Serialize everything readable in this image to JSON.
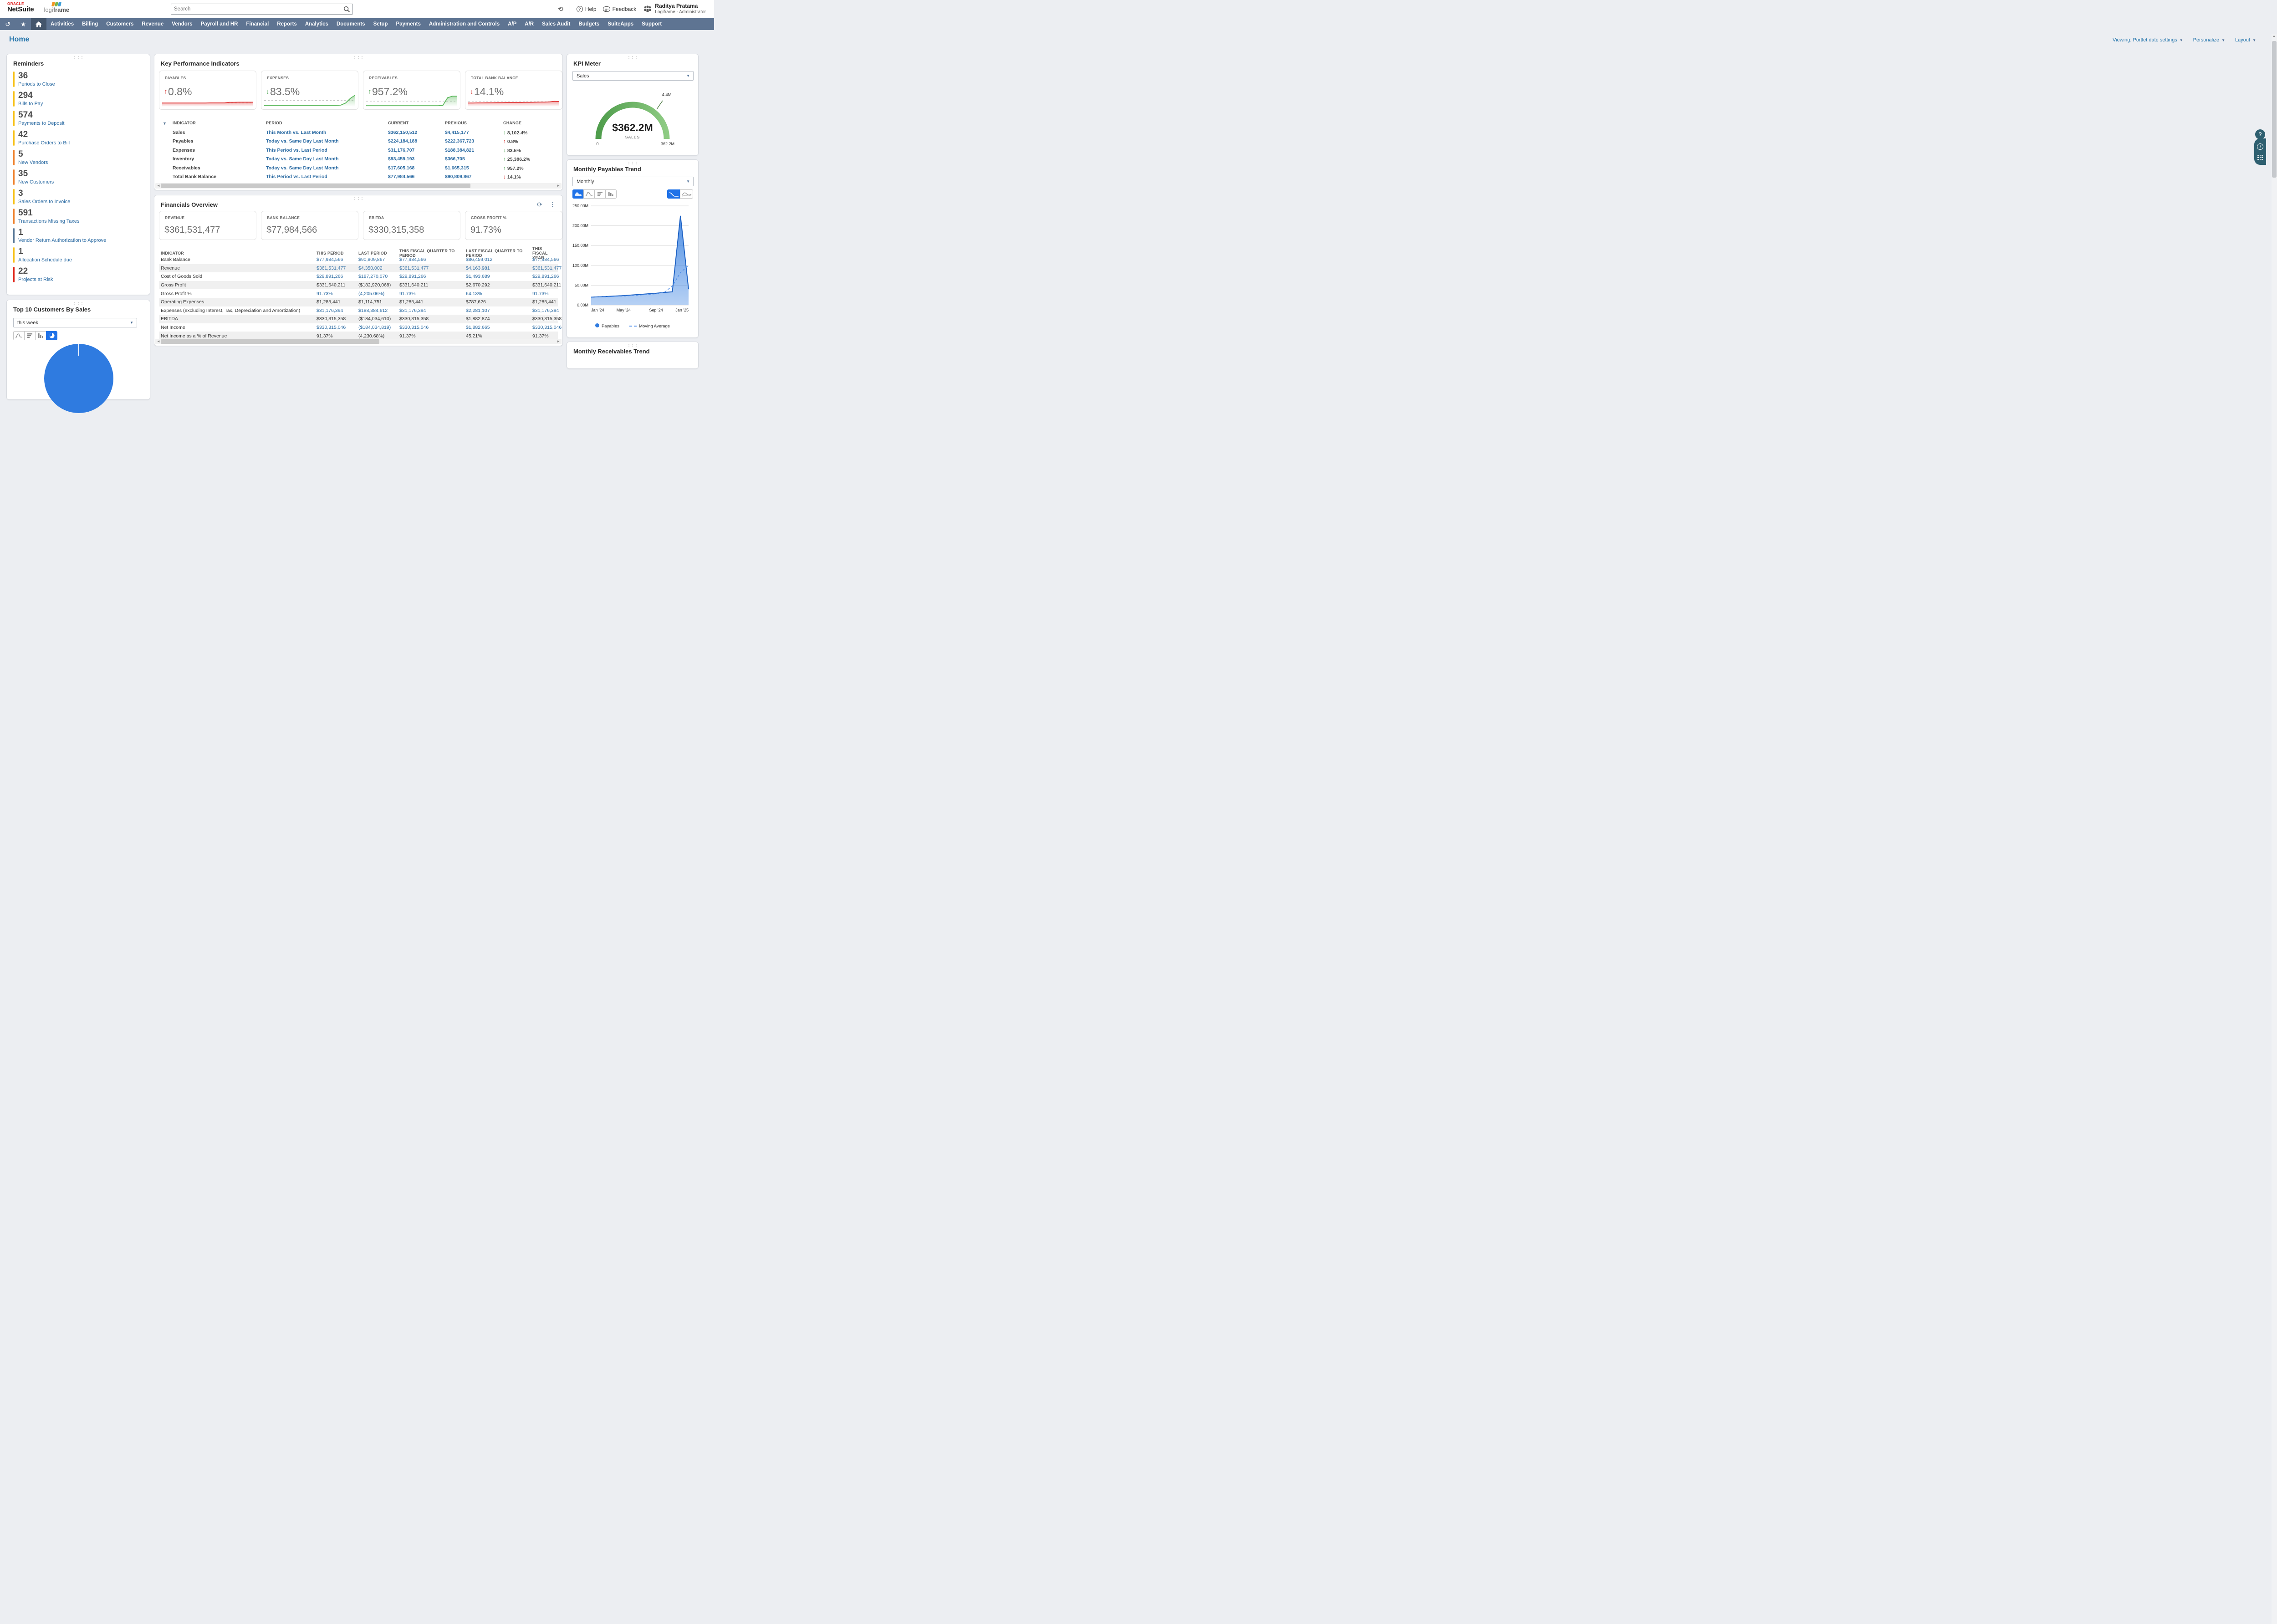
{
  "header": {
    "brand": {
      "oracle": "ORACLE",
      "netsuite": "NetSuite",
      "partner_light": "logi",
      "partner_bold": "frame"
    },
    "search": {
      "placeholder": "Search"
    },
    "help_label": "Help",
    "feedback_label": "Feedback",
    "user": {
      "name": "Raditya Pratama",
      "role": "Logiframe - Administrator"
    }
  },
  "nav": {
    "items": [
      "Activities",
      "Billing",
      "Customers",
      "Revenue",
      "Vendors",
      "Payroll and HR",
      "Financial",
      "Reports",
      "Analytics",
      "Documents",
      "Setup",
      "Payments",
      "Administration and Controls",
      "A/P",
      "A/R",
      "Sales Audit",
      "Budgets",
      "SuiteApps",
      "Support"
    ]
  },
  "page": {
    "title": "Home",
    "viewing_label": "Viewing: Portlet date settings",
    "personalize_label": "Personalize",
    "layout_label": "Layout"
  },
  "reminders": {
    "title": "Reminders",
    "items": [
      {
        "count": "36",
        "label": "Periods to Close",
        "color": "#f7c21d"
      },
      {
        "count": "294",
        "label": "Bills to Pay",
        "color": "#f7c21d"
      },
      {
        "count": "574",
        "label": "Payments to Deposit",
        "color": "#f7c21d"
      },
      {
        "count": "42",
        "label": "Purchase Orders to Bill",
        "color": "#f7c21d"
      },
      {
        "count": "5",
        "label": "New Vendors",
        "color": "#ef8432"
      },
      {
        "count": "35",
        "label": "New Customers",
        "color": "#ef8432"
      },
      {
        "count": "3",
        "label": "Sales Orders to Invoice",
        "color": "#f7c21d"
      },
      {
        "count": "591",
        "label": "Transactions Missing Taxes",
        "color": "#ef8432"
      },
      {
        "count": "1",
        "label": "Vendor Return Authorization to Approve",
        "color": "#5b7a99"
      },
      {
        "count": "1",
        "label": "Allocation Schedule due",
        "color": "#f7c21d"
      },
      {
        "count": "22",
        "label": "Projects at Risk",
        "color": "#e02b20"
      }
    ]
  },
  "top10": {
    "title": "Top 10 Customers By Sales",
    "range_value": "this week"
  },
  "kpi": {
    "title": "Key Performance Indicators",
    "cards": [
      {
        "label": "PAYABLES",
        "value": "0.8%",
        "dir": "up",
        "tone": "bad"
      },
      {
        "label": "EXPENSES",
        "value": "83.5%",
        "dir": "down",
        "tone": "good"
      },
      {
        "label": "RECEIVABLES",
        "value": "957.2%",
        "dir": "up",
        "tone": "good"
      },
      {
        "label": "TOTAL BANK BALANCE",
        "value": "14.1%",
        "dir": "down",
        "tone": "bad"
      }
    ],
    "table": {
      "headers": [
        "INDICATOR",
        "PERIOD",
        "CURRENT",
        "PREVIOUS",
        "CHANGE"
      ],
      "rows": [
        {
          "indicator": "Sales",
          "period": "This Month vs. Last Month",
          "current": "$362,150,512",
          "previous": "$4,415,177",
          "change": "8,102.4%",
          "dir": "up",
          "tone": "good"
        },
        {
          "indicator": "Payables",
          "period": "Today vs. Same Day Last Month",
          "current": "$224,184,188",
          "previous": "$222,367,723",
          "change": "0.8%",
          "dir": "up",
          "tone": "bad"
        },
        {
          "indicator": "Expenses",
          "period": "This Period vs. Last Period",
          "current": "$31,176,707",
          "previous": "$188,384,821",
          "change": "83.5%",
          "dir": "down",
          "tone": "good"
        },
        {
          "indicator": "Inventory",
          "period": "Today vs. Same Day Last Month",
          "current": "$93,459,193",
          "previous": "$366,705",
          "change": "25,386.2%",
          "dir": "up",
          "tone": "good"
        },
        {
          "indicator": "Receivables",
          "period": "Today vs. Same Day Last Month",
          "current": "$17,605,168",
          "previous": "$1,665,315",
          "change": "957.2%",
          "dir": "up",
          "tone": "good"
        },
        {
          "indicator": "Total Bank Balance",
          "period": "This Period vs. Last Period",
          "current": "$77,984,566",
          "previous": "$90,809,867",
          "change": "14.1%",
          "dir": "down",
          "tone": "bad"
        }
      ]
    }
  },
  "financials": {
    "title": "Financials Overview",
    "cards": [
      {
        "label": "REVENUE",
        "value": "$361,531,477"
      },
      {
        "label": "BANK BALANCE",
        "value": "$77,984,566"
      },
      {
        "label": "EBITDA",
        "value": "$330,315,358"
      },
      {
        "label": "GROSS PROFIT %",
        "value": "91.73%"
      }
    ],
    "table": {
      "headers": [
        "INDICATOR",
        "THIS PERIOD",
        "LAST PERIOD",
        "THIS FISCAL QUARTER TO PERIOD",
        "LAST FISCAL QUARTER TO PERIOD",
        "THIS FISCAL YEAR"
      ],
      "rows": [
        {
          "indicator": "Bank Balance",
          "values": [
            "$77,984,566",
            "$90,809,867",
            "$77,984,566",
            "$86,459,012",
            "$77,984,566"
          ],
          "link": true,
          "shaded": false
        },
        {
          "indicator": "Revenue",
          "values": [
            "$361,531,477",
            "$4,350,002",
            "$361,531,477",
            "$4,163,981",
            "$361,531,477"
          ],
          "link": true,
          "shaded": true
        },
        {
          "indicator": "Cost of Goods Sold",
          "values": [
            "$29,891,266",
            "$187,270,070",
            "$29,891,266",
            "$1,493,689",
            "$29,891,266"
          ],
          "link": true,
          "shaded": false
        },
        {
          "indicator": "Gross Profit",
          "values": [
            "$331,640,211",
            "($182,920,068)",
            "$331,640,211",
            "$2,670,292",
            "$331,640,211"
          ],
          "link": false,
          "shaded": true
        },
        {
          "indicator": "Gross Profit %",
          "values": [
            "91.73%",
            "(4,205.06%)",
            "91.73%",
            "64.13%",
            "91.73%"
          ],
          "link": true,
          "shaded": false
        },
        {
          "indicator": "Operating Expenses",
          "values": [
            "$1,285,441",
            "$1,114,751",
            "$1,285,441",
            "$787,626",
            "$1,285,441"
          ],
          "link": false,
          "shaded": true
        },
        {
          "indicator": "Expenses (excluding Interest, Tax, Depreciation and Amortization)",
          "values": [
            "$31,176,394",
            "$188,384,612",
            "$31,176,394",
            "$2,281,107",
            "$31,176,394"
          ],
          "link": true,
          "shaded": false
        },
        {
          "indicator": "EBITDA",
          "values": [
            "$330,315,358",
            "($184,034,610)",
            "$330,315,358",
            "$1,882,874",
            "$330,315,358"
          ],
          "link": false,
          "shaded": true
        },
        {
          "indicator": "Net Income",
          "values": [
            "$330,315,046",
            "($184,034,819)",
            "$330,315,046",
            "$1,882,665",
            "$330,315,046"
          ],
          "link": true,
          "shaded": false
        },
        {
          "indicator": "Net Income as a % of Revenue",
          "values": [
            "91.37%",
            "(4,230.68%)",
            "91.37%",
            "45.21%",
            "91.37%"
          ],
          "link": false,
          "shaded": true
        }
      ]
    }
  },
  "kpi_meter": {
    "title": "KPI Meter",
    "selected": "Sales",
    "value": "$362.2M",
    "value_label": "SALES",
    "min": "0",
    "max": "362.2M",
    "threshold": "4.4M"
  },
  "payables_trend": {
    "title": "Monthly Payables Trend",
    "selected": "Monthly",
    "legend_series": "Payables",
    "legend_avg": "Moving Average"
  },
  "partial_portlet": {
    "title": "Monthly Receivables Trend"
  },
  "chart_data": [
    {
      "id": "kpi_meter_gauge",
      "type": "gauge",
      "title": "KPI Meter - Sales",
      "value": 362.2,
      "unit": "M",
      "min": 0,
      "max": 362.2,
      "threshold_label": "4.4M",
      "display_value": "$362.2M",
      "color_start": "#4f9d4c",
      "color_end": "#8ecb83"
    },
    {
      "id": "payables_trend",
      "type": "area",
      "title": "Monthly Payables Trend",
      "x": [
        "Jan '24",
        "Feb '24",
        "Mar '24",
        "Apr '24",
        "May '24",
        "Jun '24",
        "Jul '24",
        "Aug '24",
        "Sep '24",
        "Oct '24",
        "Nov '24",
        "Dec '24",
        "Jan '25"
      ],
      "x_shown_ticks": [
        0,
        4,
        8,
        12
      ],
      "series": [
        {
          "name": "Payables",
          "style": "area-solid",
          "values": [
            20,
            21,
            22,
            23,
            24,
            25.5,
            27,
            28.5,
            30,
            32,
            33.5,
            225,
            40
          ]
        },
        {
          "name": "Moving Average",
          "style": "dashed",
          "values": [
            20,
            20.5,
            21,
            22,
            23,
            24,
            25.5,
            27,
            28.5,
            32,
            48,
            82,
            100
          ]
        }
      ],
      "ylabel": "",
      "xlabel": "",
      "ylim": [
        0,
        250
      ],
      "yticks": [
        "0.00M",
        "50.00M",
        "100.00M",
        "150.00M",
        "200.00M",
        "250.00M"
      ],
      "grid": true,
      "legend_position": "bottom",
      "color": "#2f7be0"
    },
    {
      "id": "spark_payables",
      "type": "line",
      "title": "Payables sparkline",
      "color": "#e03a3a",
      "baseline": 0.31,
      "values": [
        0.3,
        0.3,
        0.3,
        0.3,
        0.3,
        0.3,
        0.3,
        0.3,
        0.3,
        0.3,
        0.31,
        0.31,
        0.31,
        0.31,
        0.36,
        0.36,
        0.37,
        0.37,
        0.37,
        0.37
      ]
    },
    {
      "id": "spark_expenses",
      "type": "line",
      "title": "Expenses sparkline",
      "color": "#5cb85c",
      "baseline": 0.52,
      "values": [
        0.1,
        0.1,
        0.1,
        0.1,
        0.1,
        0.1,
        0.1,
        0.1,
        0.1,
        0.1,
        0.1,
        0.1,
        0.1,
        0.1,
        0.1,
        0.1,
        0.12,
        0.3,
        0.7,
        0.97
      ]
    },
    {
      "id": "spark_receivables",
      "type": "line",
      "title": "Receivables sparkline",
      "color": "#5cb85c",
      "baseline": 0.45,
      "values": [
        0.07,
        0.07,
        0.07,
        0.07,
        0.07,
        0.07,
        0.07,
        0.07,
        0.07,
        0.07,
        0.07,
        0.07,
        0.07,
        0.07,
        0.07,
        0.07,
        0.1,
        0.75,
        0.88,
        0.88
      ]
    },
    {
      "id": "spark_bank",
      "type": "line",
      "title": "Total Bank Balance sparkline",
      "color": "#e03a3a",
      "baseline": 0.42,
      "values": [
        0.3,
        0.3,
        0.31,
        0.31,
        0.32,
        0.32,
        0.33,
        0.33,
        0.34,
        0.34,
        0.35,
        0.35,
        0.36,
        0.36,
        0.37,
        0.38,
        0.38,
        0.4,
        0.44,
        0.42
      ]
    },
    {
      "id": "top10_pie",
      "type": "pie",
      "title": "Top 10 Customers By Sales (only top arc visible)",
      "categories": [],
      "values": [],
      "color": "#2f7be0"
    }
  ]
}
